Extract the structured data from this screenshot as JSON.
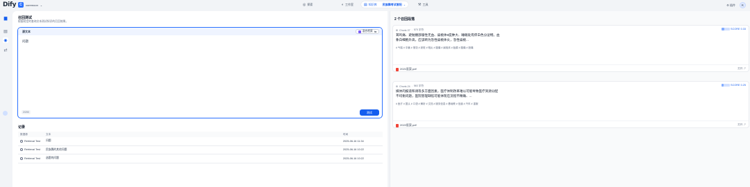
{
  "app": {
    "logo": "Dify"
  },
  "workspace": {
    "badge": "C",
    "name": "coremoon"
  },
  "nav": {
    "explore": "探索",
    "studio": "工作室",
    "knowledge": "知识库",
    "knowledge_crumb": "民族舞考试曾阳",
    "tools": "工具",
    "plugins": "插件",
    "avatar": "K"
  },
  "page": {
    "title": "召回测试",
    "subtitle": "根据给定的查询文本测试知识的召回效果。"
  },
  "query": {
    "label": "源文本",
    "method": "混合检索",
    "text": "问题",
    "char_count": "2/200",
    "test_button": "测试"
  },
  "records": {
    "title": "记录",
    "columns": [
      "数据源",
      "文本",
      "时间"
    ],
    "rows": [
      {
        "source": "Retrieval Test",
        "text": "问题",
        "time": "2025-06-16 11:34"
      },
      {
        "source": "Retrieval Test",
        "text": "民族舞的其他问题",
        "time": "2025-06-16 10:22"
      },
      {
        "source": "Retrieval Test",
        "text": "选题的问题",
        "time": "2025-06-16 10:22"
      }
    ]
  },
  "results": {
    "title": "2 个召回段落",
    "open_label": "打开",
    "items": [
      {
        "chunk": "Chunk-37",
        "chars": "575 字符",
        "score_label": "SCORE 0.33",
        "score": 0.33,
        "text": "耳鸣痛、避勉腰部僵性无血、扁桃体8度肿大、睡眠处有痒白色分泌物。血象白细胞升高，应该断为急性扁桃体炎，急性扁桃...",
        "tags": "# 气喘 # 中暑 # 紧张 # 瘀斑 # 咽炎 # 腹痛 # 扁桃体 # 胎腺 # 腹痛 # 股痛",
        "file": "2021医案.pdf"
      },
      {
        "chunk": "Chunk-24",
        "chars": "563 字符",
        "score_label": "SCORE 0.25",
        "score": 0.25,
        "text": "媒体的报道和调等多方面因素，医疗体制改革难以可能导致医疗资源分配不均衡问题，医院管理缺陷可能体现在流程不精确、...",
        "tags": "# 医疗 # 国认 # 口语 # 解析 # 文档 # 服务信息 # 基础教 # 信道 # 汽车 # 重服",
        "file": "2022医案.pdf"
      }
    ]
  },
  "colors": {
    "accent": "#155eef",
    "border_active": "#2970ff"
  }
}
